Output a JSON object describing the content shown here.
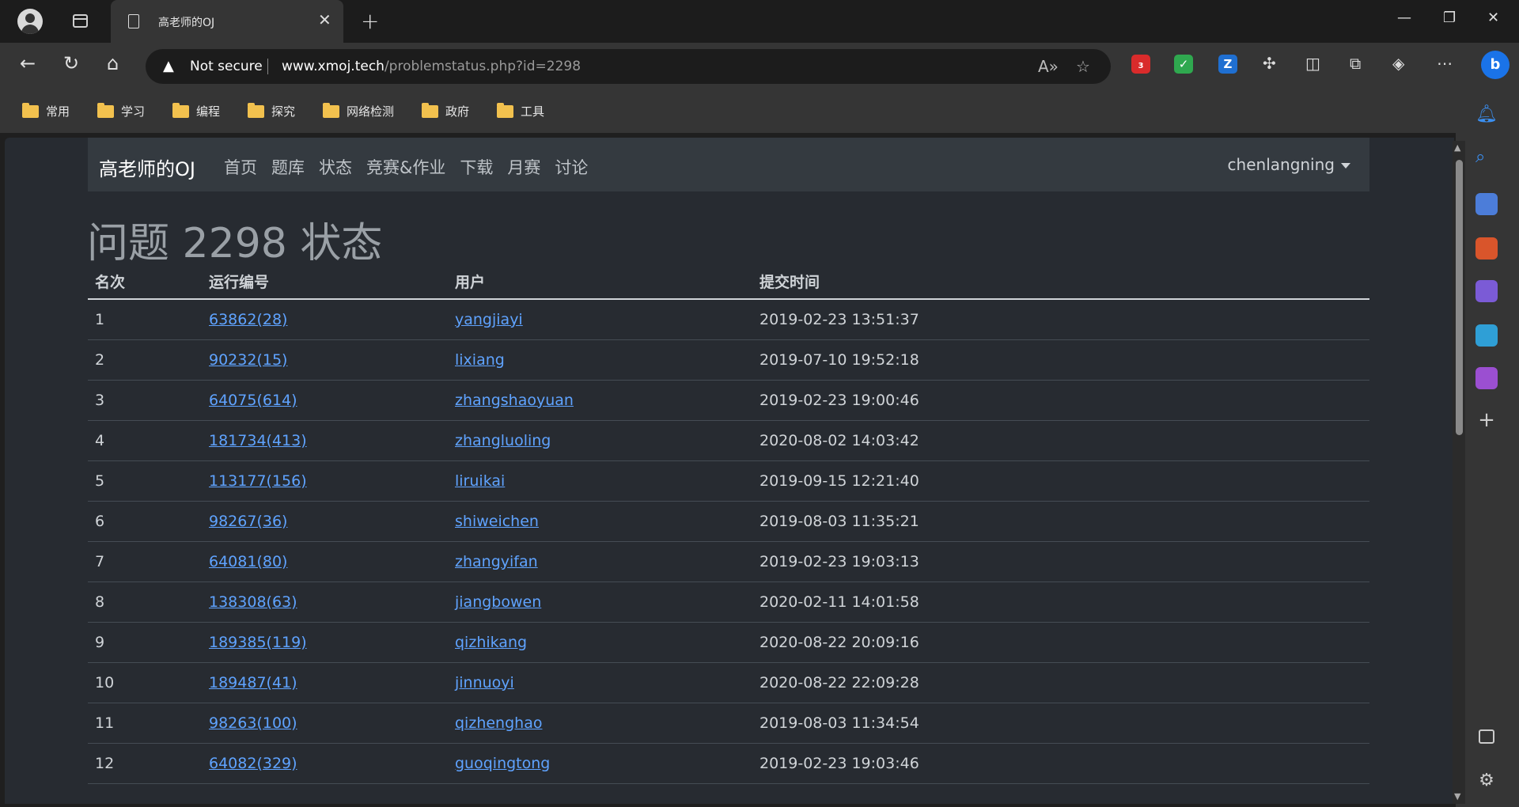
{
  "browser": {
    "tab_title": "高老师的OJ",
    "security_label": "Not secure",
    "url_host": "www.xmoj.tech",
    "url_path": "/problemstatus.php?id=2298",
    "ext_badge": "3",
    "bookmarks": [
      "常用",
      "学习",
      "编程",
      "探究",
      "网络检测",
      "政府",
      "工具"
    ]
  },
  "site": {
    "brand": "高老师的OJ",
    "nav": [
      "首页",
      "题库",
      "状态",
      "竞赛&作业",
      "下载",
      "月赛",
      "讨论"
    ],
    "user": "chenlangning"
  },
  "page": {
    "heading": "问题 2298 状态",
    "columns": [
      "名次",
      "运行编号",
      "用户",
      "提交时间"
    ],
    "rows": [
      {
        "rank": "1",
        "run": "63862(28)",
        "user": "yangjiayi",
        "time": "2019-02-23 13:51:37"
      },
      {
        "rank": "2",
        "run": "90232(15)",
        "user": "lixiang",
        "time": "2019-07-10 19:52:18"
      },
      {
        "rank": "3",
        "run": "64075(614)",
        "user": "zhangshaoyuan",
        "time": "2019-02-23 19:00:46"
      },
      {
        "rank": "4",
        "run": "181734(413)",
        "user": "zhangluoling",
        "time": "2020-08-02 14:03:42"
      },
      {
        "rank": "5",
        "run": "113177(156)",
        "user": "liruikai",
        "time": "2019-09-15 12:21:40"
      },
      {
        "rank": "6",
        "run": "98267(36)",
        "user": "shiweichen",
        "time": "2019-08-03 11:35:21"
      },
      {
        "rank": "7",
        "run": "64081(80)",
        "user": "zhangyifan",
        "time": "2019-02-23 19:03:13"
      },
      {
        "rank": "8",
        "run": "138308(63)",
        "user": "jiangbowen",
        "time": "2020-02-11 14:01:58"
      },
      {
        "rank": "9",
        "run": "189385(119)",
        "user": "qizhikang",
        "time": "2020-08-22 20:09:16"
      },
      {
        "rank": "10",
        "run": "189487(41)",
        "user": "jinnuoyi",
        "time": "2020-08-22 22:09:28"
      },
      {
        "rank": "11",
        "run": "98263(100)",
        "user": "qizhenghao",
        "time": "2019-08-03 11:34:54"
      },
      {
        "rank": "12",
        "run": "64082(329)",
        "user": "guoqingtong",
        "time": "2019-02-23 19:03:46"
      }
    ]
  }
}
